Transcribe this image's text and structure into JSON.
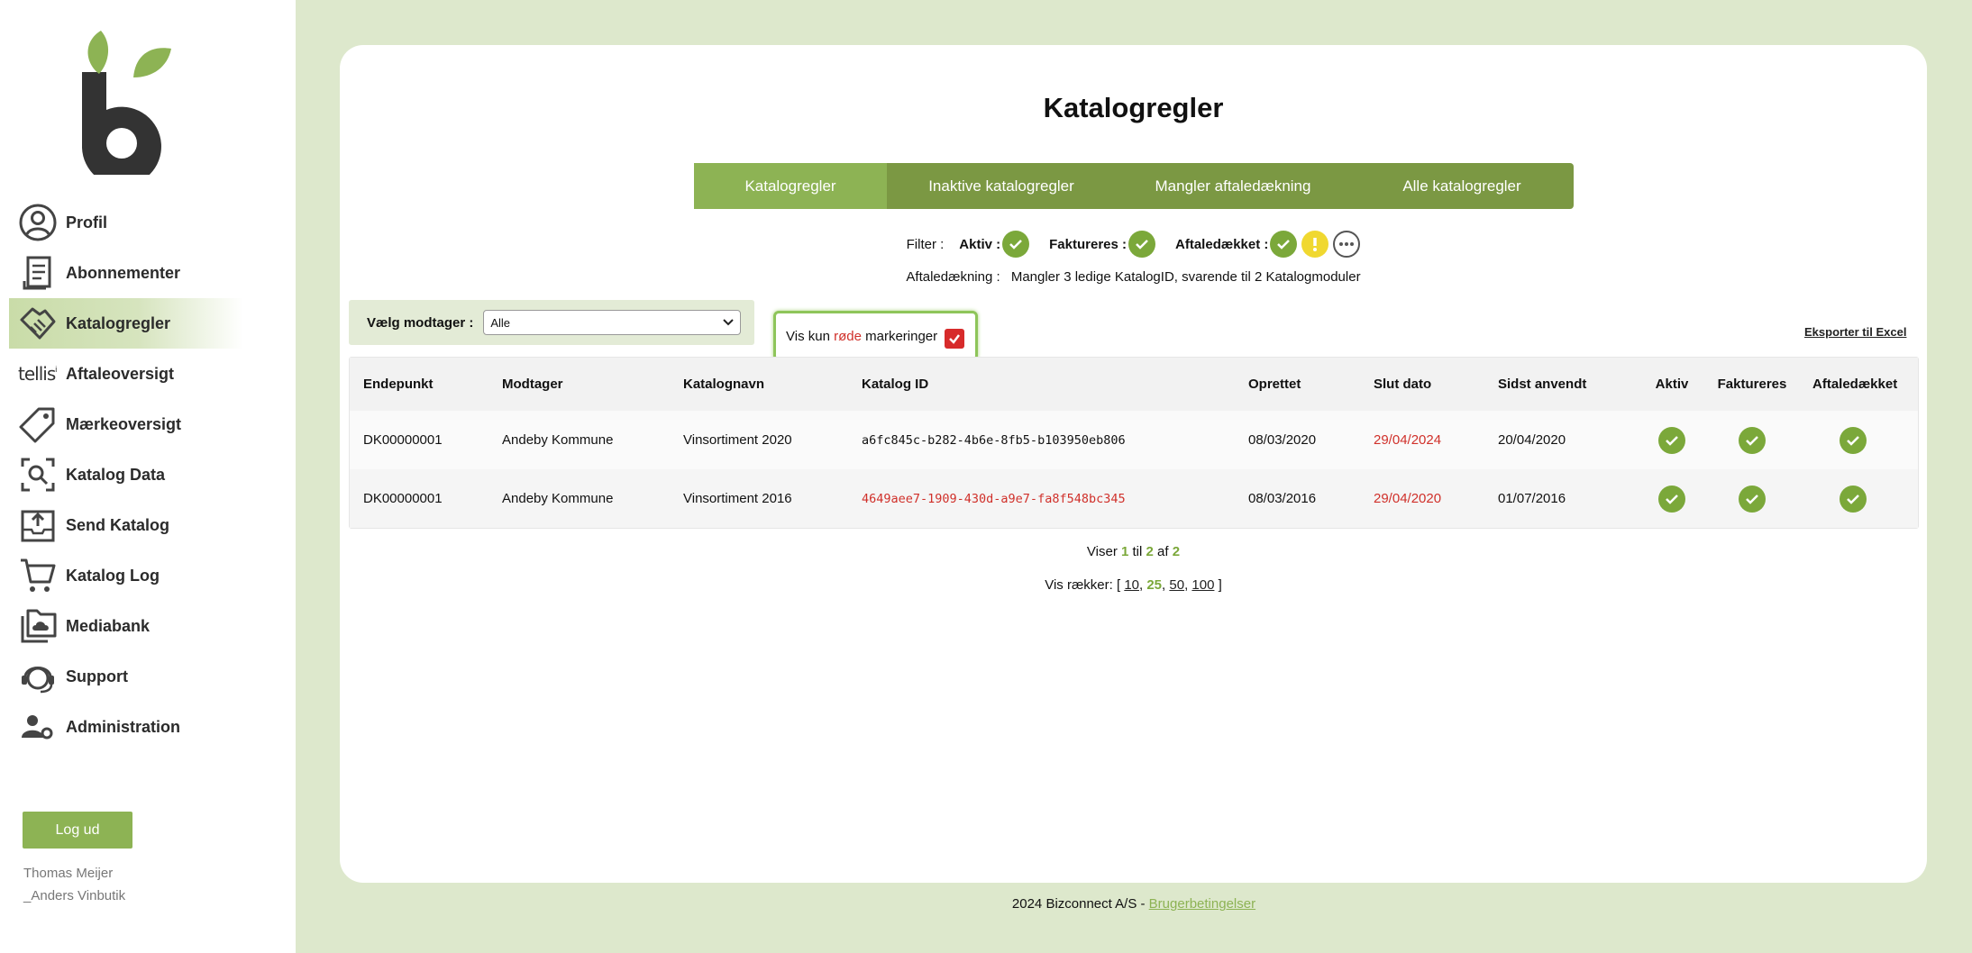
{
  "sidebar": {
    "items": [
      {
        "label": "Profil",
        "icon": "profile-icon"
      },
      {
        "label": "Abonnementer",
        "icon": "document-icon"
      },
      {
        "label": "Katalogregler",
        "icon": "handshake-icon",
        "active": true
      },
      {
        "label": "Aftaleoversigt",
        "icon": "tellis-logo"
      },
      {
        "label": "Mærkeoversigt",
        "icon": "tag-icon"
      },
      {
        "label": "Katalog Data",
        "icon": "search-data-icon"
      },
      {
        "label": "Send Katalog",
        "icon": "upload-icon"
      },
      {
        "label": "Katalog Log",
        "icon": "cart-icon"
      },
      {
        "label": "Mediabank",
        "icon": "cloud-folder-icon"
      },
      {
        "label": "Support",
        "icon": "headset-icon"
      },
      {
        "label": "Administration",
        "icon": "users-gear-icon"
      }
    ],
    "tellis_text": "tellis",
    "logout_label": "Log ud",
    "user_name": "Thomas Meijer",
    "user_shop": "_Anders Vinbutik"
  },
  "main": {
    "title": "Katalogregler",
    "tabs": [
      {
        "label": "Katalogregler",
        "active": true
      },
      {
        "label": "Inaktive katalogregler"
      },
      {
        "label": "Mangler aftaledækning"
      },
      {
        "label": "Alle katalogregler"
      }
    ],
    "filter": {
      "label": "Filter :",
      "aktiv_label": "Aktiv :",
      "faktureres_label": "Faktureres :",
      "aftaledaekket_label": "Aftaledækket :"
    },
    "coverage": {
      "label": "Aftaledækning :",
      "text": "Mangler 3 ledige KatalogID, svarende til 2 Katalogmoduler"
    },
    "receiver": {
      "label": "Vælg modtager :",
      "value": "Alle"
    },
    "red_only": {
      "prefix": "Vis kun",
      "red_word": "røde",
      "suffix": "markeringer",
      "checked": true
    },
    "export_label": "Eksporter til Excel",
    "table": {
      "headers": [
        "Endepunkt",
        "Modtager",
        "Katalognavn",
        "Katalog ID",
        "Oprettet",
        "Slut dato",
        "Sidst anvendt",
        "Aktiv",
        "Faktureres",
        "Aftaledækket"
      ],
      "rows": [
        {
          "endepunkt": "DK00000001",
          "modtager": "Andeby Kommune",
          "katalognavn": "Vinsortiment 2020",
          "katalog_id": "a6fc845c-b282-4b6e-8fb5-b103950eb806",
          "katalog_id_red": false,
          "oprettet": "08/03/2020",
          "slut_dato": "29/04/2024",
          "sidst_anvendt": "20/04/2020"
        },
        {
          "endepunkt": "DK00000001",
          "modtager": "Andeby Kommune",
          "katalognavn": "Vinsortiment 2016",
          "katalog_id": "4649aee7-1909-430d-a9e7-fa8f548bc345",
          "katalog_id_red": true,
          "oprettet": "08/03/2016",
          "slut_dato": "29/04/2020",
          "sidst_anvendt": "01/07/2016"
        }
      ]
    },
    "pager": {
      "prefix": "Viser",
      "from": "1",
      "to_word": "til",
      "to": "2",
      "of_word": "af",
      "total": "2"
    },
    "rows_select": {
      "label": "Vis rækker:",
      "options": [
        "10",
        "25",
        "50",
        "100"
      ],
      "selected": "25"
    }
  },
  "footer": {
    "text": "2024 Bizconnect A/S -",
    "link": "Brugerbetingelser"
  },
  "colors": {
    "accent": "#8db354",
    "tab_bg": "#7b9843",
    "check_green": "#7ba83a",
    "red": "#d0302a",
    "page_bg": "#dde8cc"
  }
}
